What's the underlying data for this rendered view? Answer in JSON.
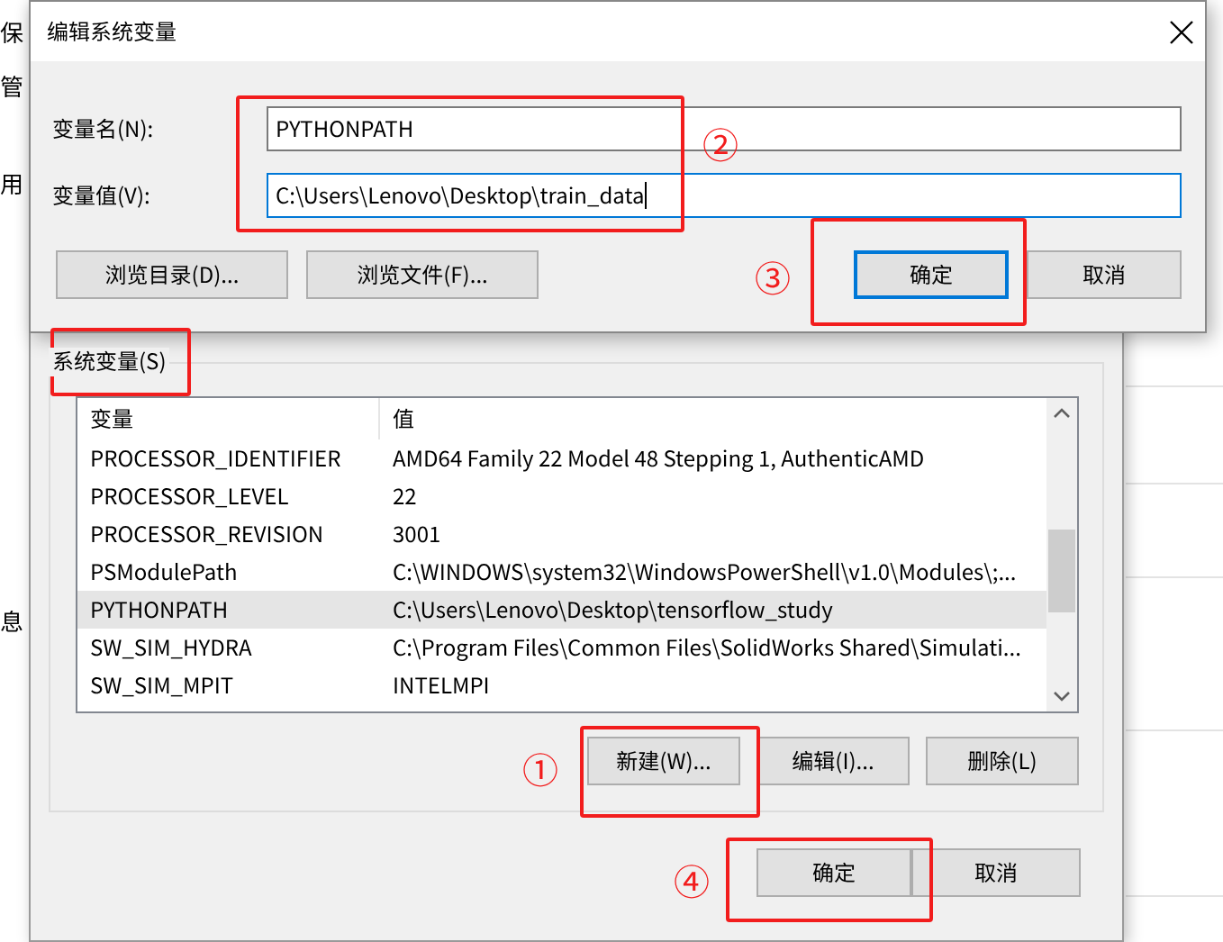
{
  "background_window": {
    "fragments": [
      "保",
      "管",
      "用",
      "息"
    ]
  },
  "env_dialog": {
    "group_label": "系统变量(S)",
    "table": {
      "columns": [
        "变量",
        "值"
      ],
      "rows": [
        {
          "cells": [
            "PROCESSOR_IDENTIFIER",
            "AMD64 Family 22 Model 48 Stepping 1, AuthenticAMD"
          ],
          "selected": false
        },
        {
          "cells": [
            "PROCESSOR_LEVEL",
            "22"
          ],
          "selected": false
        },
        {
          "cells": [
            "PROCESSOR_REVISION",
            "3001"
          ],
          "selected": false
        },
        {
          "cells": [
            "PSModulePath",
            "C:\\WINDOWS\\system32\\WindowsPowerShell\\v1.0\\Modules\\;..."
          ],
          "selected": false
        },
        {
          "cells": [
            "PYTHONPATH",
            "C:\\Users\\Lenovo\\Desktop\\tensorflow_study"
          ],
          "selected": true
        },
        {
          "cells": [
            "SW_SIM_HYDRA",
            "C:\\Program Files\\Common Files\\SolidWorks Shared\\Simulati..."
          ],
          "selected": false
        },
        {
          "cells": [
            "SW_SIM_MPIT",
            "INTELMPI"
          ],
          "selected": false
        }
      ]
    },
    "list_buttons": [
      "新建(W)...",
      "编辑(I)...",
      "删除(L)"
    ],
    "buttons": [
      "确定",
      "取消"
    ]
  },
  "edit_dialog": {
    "title": "编辑系统变量",
    "fields": [
      {
        "label": "变量名(N):",
        "value": "PYTHONPATH",
        "focused": false
      },
      {
        "label": "变量值(V):",
        "value": "C:\\Users\\Lenovo\\Desktop\\train_data",
        "focused": true
      }
    ],
    "buttons": [
      {
        "label": "浏览目录(D)...",
        "default": false
      },
      {
        "label": "浏览文件(F)...",
        "default": false
      },
      {
        "label": "确定",
        "default": true
      },
      {
        "label": "取消",
        "default": false
      }
    ]
  },
  "annotations": [
    {
      "marker": "①"
    },
    {
      "marker": "②"
    },
    {
      "marker": "③"
    },
    {
      "marker": "④"
    }
  ]
}
